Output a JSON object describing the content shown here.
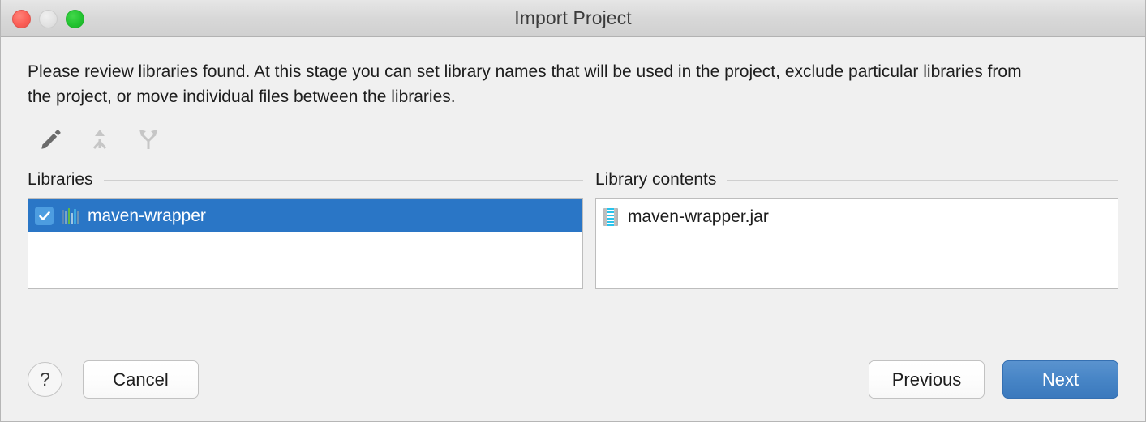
{
  "window": {
    "title": "Import Project",
    "traffic_lights": [
      {
        "name": "close",
        "color": "#fb5f57",
        "enabled": true
      },
      {
        "name": "minimize",
        "color": "#e2e2e2",
        "enabled": false
      },
      {
        "name": "zoom",
        "color": "#23c431",
        "enabled": true
      }
    ]
  },
  "intro": {
    "text": "Please review libraries found. At this stage you can set library names that will be used in the project, exclude particular libraries from the project, or move individual files between the libraries."
  },
  "toolbar": {
    "buttons": [
      {
        "name": "edit-pencil-icon",
        "label": "Edit",
        "enabled": true,
        "color": "#6b6b6b"
      },
      {
        "name": "merge-icon",
        "label": "Merge",
        "enabled": false,
        "color": "#c6c6c6"
      },
      {
        "name": "split-icon",
        "label": "Split",
        "enabled": false,
        "color": "#c6c6c6"
      }
    ]
  },
  "libraries_panel": {
    "title": "Libraries",
    "items": [
      {
        "label": "maven-wrapper",
        "checked": true,
        "selected": true,
        "icon": "library-books-icon"
      }
    ]
  },
  "contents_panel": {
    "title": "Library contents",
    "items": [
      {
        "label": "maven-wrapper.jar",
        "selected": false,
        "icon": "jar-archive-icon"
      }
    ]
  },
  "footer": {
    "help_label": "?",
    "cancel_label": "Cancel",
    "previous_label": "Previous",
    "next_label": "Next"
  },
  "colors": {
    "selection_blue": "#2a76c6",
    "default_button_blue": "#4785c6",
    "checkbox_blue": "#4d9de0",
    "dialog_background": "#f0f0f0",
    "titlebar_background": "#d8d8d8"
  }
}
